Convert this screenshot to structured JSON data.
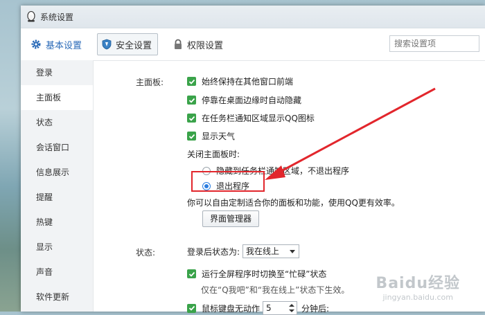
{
  "window": {
    "title": "系统设置"
  },
  "toolbar": {
    "tabs": [
      {
        "label": "基本设置"
      },
      {
        "label": "安全设置"
      },
      {
        "label": "权限设置"
      }
    ],
    "search_placeholder": "搜索设置项"
  },
  "sidebar": {
    "items": [
      {
        "label": "登录"
      },
      {
        "label": "主面板"
      },
      {
        "label": "状态"
      },
      {
        "label": "会话窗口"
      },
      {
        "label": "信息展示"
      },
      {
        "label": "提醒"
      },
      {
        "label": "热键"
      },
      {
        "label": "显示"
      },
      {
        "label": "声音"
      },
      {
        "label": "软件更新"
      }
    ],
    "active_index": 1
  },
  "main_panel": {
    "section_label": "主面板:",
    "options": [
      {
        "label": "始终保持在其他窗口前端",
        "checked": true
      },
      {
        "label": "停靠在桌面边缘时自动隐藏",
        "checked": true
      },
      {
        "label": "在任务栏通知区域显示QQ图标",
        "checked": true
      },
      {
        "label": "显示天气",
        "checked": true
      }
    ],
    "close_label": "关闭主面板时:",
    "radio_options": [
      {
        "label": "隐藏到任务栏通知区域，不退出程序",
        "selected": false
      },
      {
        "label": "退出程序",
        "selected": true
      }
    ],
    "customize_hint": "你可以自由定制适合你的面板和功能，使用QQ更有效率。",
    "ui_manager_button": "界面管理器"
  },
  "status": {
    "section_label": "状态:",
    "after_login_label": "登录后状态为:",
    "after_login_value": "我在线上",
    "fullscreen_option": "运行全屏程序时切换至“忙碌”状态",
    "fullscreen_hint": "仅在“Q我吧”和“我在线上”状态下生效。",
    "idle_option": "鼠标键盘无动作",
    "idle_minutes": "5",
    "idle_suffix": "分钟后:"
  },
  "watermark": {
    "brand": "Baidu经验",
    "url": "jingyan.baidu.com"
  },
  "colors": {
    "check_green": "#3aa34a",
    "accent_blue": "#2b6bb8",
    "annotation_red": "#e2262c"
  }
}
